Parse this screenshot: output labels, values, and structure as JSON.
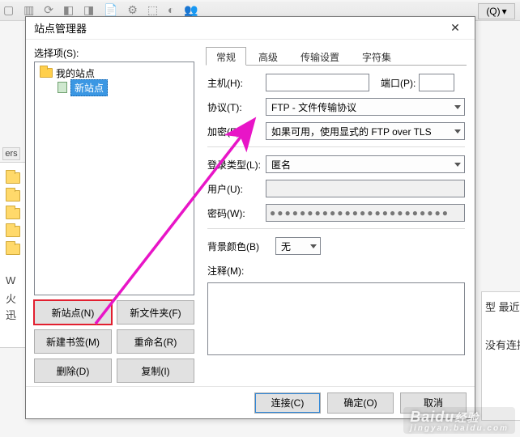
{
  "bg": {
    "q_label": "(Q)",
    "ers_label": "ers",
    "side_letters": [
      "W",
      "火",
      "迅"
    ],
    "right_items": [
      "型   最近",
      "没有连接"
    ]
  },
  "dialog": {
    "title": "站点管理器",
    "select_label": "选择项(S):",
    "tree": {
      "root_label": "我的站点",
      "site_label": "新站点"
    },
    "buttons": {
      "new_site": "新站点(N)",
      "new_folder": "新文件夹(F)",
      "new_bookmark": "新建书签(M)",
      "rename": "重命名(R)",
      "delete": "删除(D)",
      "copy": "复制(I)"
    },
    "tabs": {
      "general": "常规",
      "advanced": "高级",
      "transfer": "传输设置",
      "charset": "字符集"
    },
    "form": {
      "host_label": "主机(H):",
      "host_value": "",
      "port_label": "端口(P):",
      "port_value": "",
      "protocol_label": "协议(T):",
      "protocol_value": "FTP - 文件传输协议",
      "encryption_label": "加密(E):",
      "encryption_value": "如果可用，使用显式的 FTP over TLS",
      "logintype_label": "登录类型(L):",
      "logintype_value": "匿名",
      "user_label": "用户(U):",
      "user_value": "",
      "password_label": "密码(W):",
      "password_value": "●●●●●●●●●●●●●●●●●●●●●●●●",
      "bgcolor_label": "背景颜色(B)",
      "bgcolor_value": "无",
      "notes_label": "注释(M):",
      "notes_value": ""
    },
    "footer": {
      "connect": "连接(C)",
      "ok": "确定(O)",
      "cancel": "取消"
    }
  },
  "watermark": {
    "brand": "Baidu",
    "sub": "jingyan.baidu.com",
    "extra": "经验"
  }
}
